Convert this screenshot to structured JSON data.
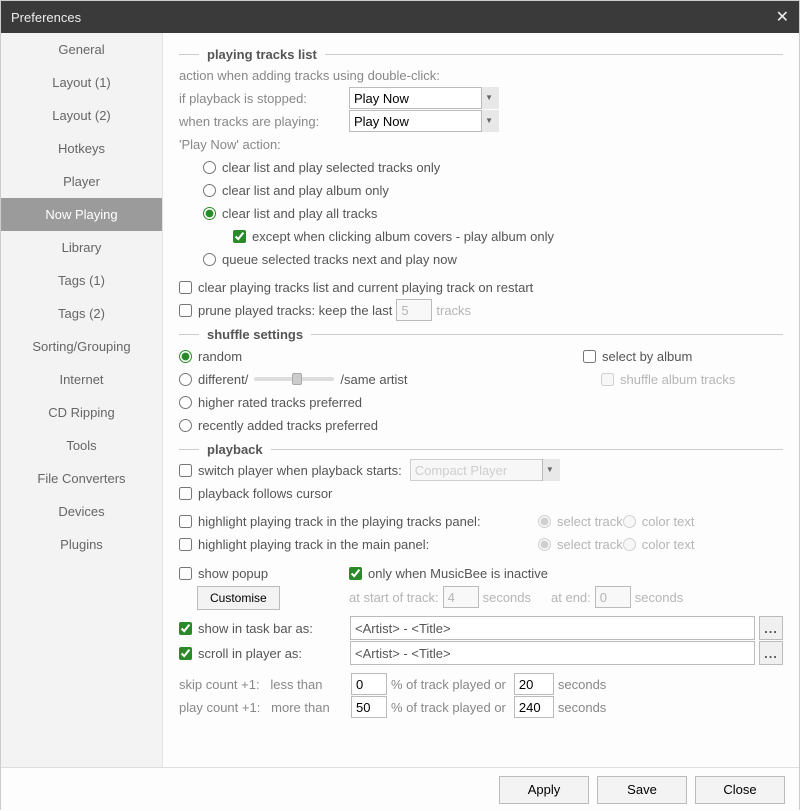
{
  "window": {
    "title": "Preferences",
    "close": "✕"
  },
  "sidebar": {
    "items": [
      {
        "label": "General"
      },
      {
        "label": "Layout (1)"
      },
      {
        "label": "Layout (2)"
      },
      {
        "label": "Hotkeys"
      },
      {
        "label": "Player"
      },
      {
        "label": "Now Playing",
        "selected": true
      },
      {
        "label": "Library"
      },
      {
        "label": "Tags (1)"
      },
      {
        "label": "Tags (2)"
      },
      {
        "label": "Sorting/Grouping"
      },
      {
        "label": "Internet"
      },
      {
        "label": "CD Ripping"
      },
      {
        "label": "Tools"
      },
      {
        "label": "File Converters"
      },
      {
        "label": "Devices"
      },
      {
        "label": "Plugins"
      }
    ]
  },
  "sections": {
    "playing_tracks": {
      "header": "playing tracks list",
      "desc": "action when adding tracks using double-click:",
      "if_stopped_label": "if playback is stopped:",
      "if_stopped_value": "Play Now",
      "when_playing_label": "when tracks are playing:",
      "when_playing_value": "Play Now",
      "play_now_action_label": "'Play Now' action:",
      "radios": {
        "r1": "clear list and play selected tracks only",
        "r2": "clear list and play album only",
        "r3": "clear list and play all tracks",
        "r3_sub": "except when clicking album covers - play album only",
        "r4": "queue selected tracks next and play now"
      },
      "clear_on_restart": "clear playing tracks list and current playing track on restart",
      "prune_prefix": "prune played tracks: keep the last",
      "prune_value": "5",
      "prune_suffix": "tracks"
    },
    "shuffle": {
      "header": "shuffle settings",
      "random": "random",
      "different": "different/",
      "same_artist": "/same artist",
      "higher_rated": "higher rated tracks preferred",
      "recently_added": "recently added tracks preferred",
      "select_by_album": "select by album",
      "shuffle_album_tracks": "shuffle album tracks"
    },
    "playback": {
      "header": "playback",
      "switch_player": "switch player when playback starts:",
      "switch_player_value": "Compact Player",
      "follows_cursor": "playback follows cursor",
      "highlight_playing_panel": "highlight playing track in the playing tracks panel:",
      "highlight_main_panel": "highlight playing track in the main panel:",
      "select_track": "select track",
      "color_text": "color text",
      "show_popup": "show popup",
      "customise": "Customise",
      "only_inactive": "only when MusicBee is inactive",
      "at_start": "at start of track:",
      "at_start_val": "4",
      "at_end": "at end:",
      "at_end_val": "0",
      "seconds": "seconds",
      "show_taskbar": "show in task bar as:",
      "scroll_player": "scroll in player as:",
      "format_value": "<Artist> - <Title>",
      "skip_label": "skip count +1:   less than",
      "skip_pct": "0",
      "play_label": "play count +1:   more than",
      "play_pct": "50",
      "pct_text": "% of track played or",
      "skip_sec": "20",
      "play_sec": "240"
    }
  },
  "footer": {
    "apply": "Apply",
    "save": "Save",
    "close": "Close"
  }
}
